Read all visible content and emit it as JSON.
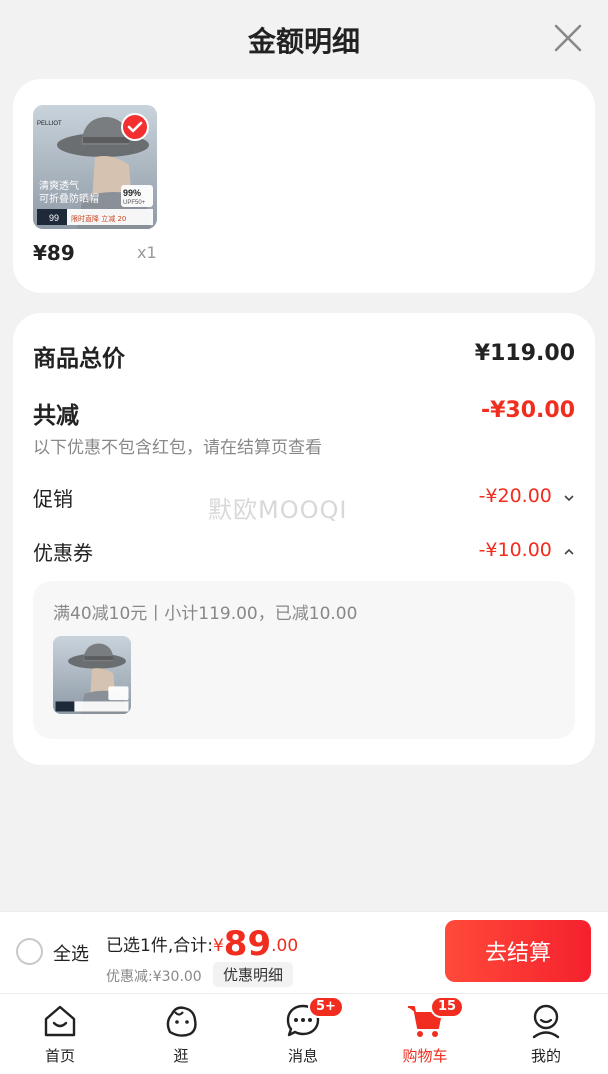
{
  "header": {
    "title": "金额明细"
  },
  "product": {
    "image_text_line1": "清爽透气",
    "image_text_line2": "可折叠防晒帽",
    "image_brand": "PELLIOT",
    "image_badge_pct": "99%",
    "image_badge_upf": "UPF50+",
    "image_price": "99",
    "image_promo": "限时直降 立减 20",
    "price": "¥89",
    "qty": "x1"
  },
  "summary": {
    "total_label": "商品总价",
    "total_value": "¥119.00",
    "reduce_label": "共减",
    "reduce_value": "-¥30.00",
    "reduce_note": "以下优惠不包含红包，请在结算页查看",
    "promo_label": "促销",
    "promo_value": "-¥20.00",
    "coupon_label": "优惠券",
    "coupon_value": "-¥10.00",
    "coupon_detail": "满40减10元丨小计119.00，已减10.00"
  },
  "watermark": "默欧MOOQI",
  "checkout": {
    "select_all": "全选",
    "summary_prefix": "已选1件,合计:",
    "yuan": "¥",
    "amount_int": "89",
    "amount_dec": ".00",
    "discount": "优惠减:¥30.00",
    "detail_chip": "优惠明细",
    "pay_button": "去结算"
  },
  "tabs": [
    {
      "label": "首页",
      "icon": "home-icon"
    },
    {
      "label": "逛",
      "icon": "explore-icon"
    },
    {
      "label": "消息",
      "icon": "message-icon",
      "badge": "5+"
    },
    {
      "label": "购物车",
      "icon": "cart-icon",
      "badge": "15",
      "active": true
    },
    {
      "label": "我的",
      "icon": "profile-icon"
    }
  ],
  "colors": {
    "accent": "#f02d1e",
    "background": "#f2f2f2"
  }
}
